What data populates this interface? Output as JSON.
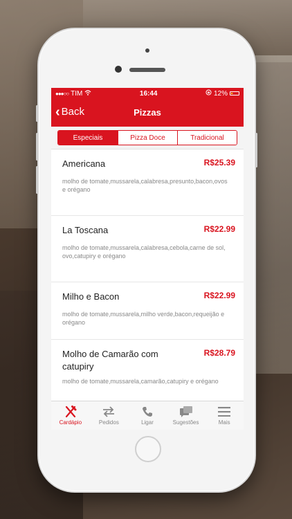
{
  "status": {
    "carrier": "TIM",
    "time": "16:44",
    "battery": "12%"
  },
  "nav": {
    "back_label": "Back",
    "title": "Pizzas"
  },
  "segments": [
    {
      "label": "Especiais",
      "active": true
    },
    {
      "label": "Pizza Doce",
      "active": false
    },
    {
      "label": "Tradicional",
      "active": false
    }
  ],
  "items": [
    {
      "name": "Americana",
      "price": "R$25.39",
      "desc": "molho de tomate,mussarela,calabresa,presunto,bacon,ovos e orégano"
    },
    {
      "name": "La Toscana",
      "price": "R$22.99",
      "desc": "molho de tomate,mussarela,calabresa,cebola,carne de sol,ovo,catupiry e orégano"
    },
    {
      "name": "Milho e Bacon",
      "price": "R$22.99",
      "desc": "molho de tomate,mussarela,milho verde,bacon,requeijão e orégano"
    },
    {
      "name": "Molho de Camarão com catupiry",
      "price": "R$28.79",
      "desc": "molho de tomate,mussarela,camarão,catupiry e orégano"
    }
  ],
  "tabs": [
    {
      "label": "Cardápio",
      "icon": "fork-knife-icon",
      "active": true
    },
    {
      "label": "Pedidos",
      "icon": "swap-arrows-icon",
      "active": false
    },
    {
      "label": "Ligar",
      "icon": "phone-icon",
      "active": false
    },
    {
      "label": "Sugestões",
      "icon": "chat-bubbles-icon",
      "active": false
    },
    {
      "label": "Mais",
      "icon": "menu-icon",
      "active": false
    }
  ],
  "colors": {
    "accent": "#d9141f"
  }
}
